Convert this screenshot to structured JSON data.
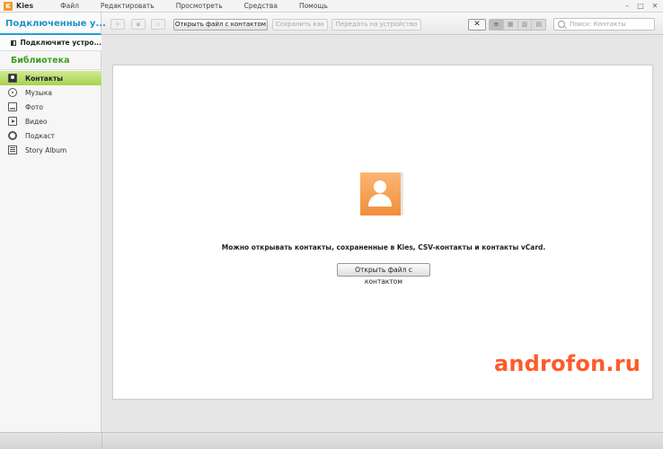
{
  "app": {
    "name": "Kies",
    "logo_letter": "K"
  },
  "menu": [
    "Файл",
    "Редактировать",
    "Просмотреть",
    "Средства",
    "Помощь"
  ],
  "window_controls": {
    "minimize": "–",
    "maximize": "□",
    "close": "✕"
  },
  "device_header": "Подключенные у...",
  "toolbar": {
    "icons": [
      "add-icon",
      "delete-icon",
      "merge-icon"
    ],
    "open_contact_file": "Открыть файл с контактом",
    "save_as": "Сохранить как",
    "transfer_to_device": "Передать на устройство",
    "close_label": "✕",
    "view_modes": [
      "≡",
      "▦",
      "▥",
      "▤"
    ]
  },
  "search": {
    "placeholder": "Поиск: Контакты"
  },
  "sidebar": {
    "connect_device": "Подключите устро...",
    "library_header": "Библиотека",
    "items": [
      {
        "label": "Контакты",
        "icon": "contacts-icon",
        "active": true
      },
      {
        "label": "Музыка",
        "icon": "music-icon",
        "active": false
      },
      {
        "label": "Фото",
        "icon": "photo-icon",
        "active": false
      },
      {
        "label": "Видео",
        "icon": "video-icon",
        "active": false
      },
      {
        "label": "Подкаст",
        "icon": "podcast-icon",
        "active": false
      },
      {
        "label": "Story Album",
        "icon": "story-album-icon",
        "active": false
      }
    ]
  },
  "main": {
    "message": "Можно открывать контакты, сохраненные в Kies, CSV-контакты и контакты vCard.",
    "open_button": "Открыть файл с контактом"
  },
  "watermark": "androfon.ru",
  "colors": {
    "accent_blue": "#1f93c8",
    "library_green": "#3e9d22",
    "active_item": "#a8d24d",
    "contact_icon": "#f18e3c",
    "watermark": "#ff5a2a"
  }
}
